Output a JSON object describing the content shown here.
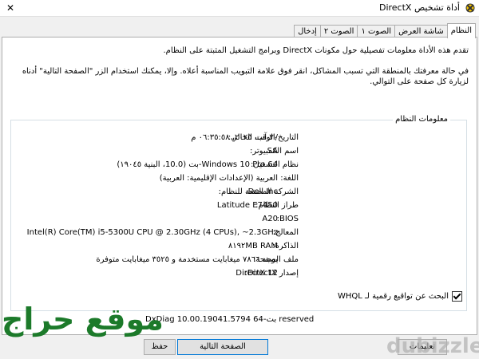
{
  "window": {
    "title": "أداة تشخيص DirectX",
    "close_label": "✕"
  },
  "tabs": [
    {
      "label": "النظام",
      "active": true
    },
    {
      "label": "شاشة العرض",
      "active": false
    },
    {
      "label": "الصوت ١",
      "active": false
    },
    {
      "label": "الصوت ٢",
      "active": false
    },
    {
      "label": "إدخال",
      "active": false
    }
  ],
  "intro": {
    "line1": "تقدم هذه الأداة معلومات تفصيلية حول مكونات DirectX وبرامج التشغيل المثبتة على النظام.",
    "line2": "في حالة معرفتك بالمنطقة التي تسبب المشاكل، انقر فوق علامة التبويب المناسبة أعلاه. وإلا، يمكنك استخدام الزر \"الصفحة التالية\" أدناه لزيارة كل صفحة على التوالي."
  },
  "system_info": {
    "title": "معلومات النظام",
    "rows": [
      {
        "label": "التاريخ/الوقت الحالي:",
        "value": "٣٠ آب، ٢٠٢٥، ٠٦:٣٥:٥٨ م"
      },
      {
        "label": "اسم الكمبيوتر:",
        "value": "SA"
      },
      {
        "label": "نظام التشغيل:",
        "value": "Windows 10 Pro 64-بت (10.0، البنية ١٩٠٤٥)"
      },
      {
        "label": "اللغة:",
        "value": "العربية (الإعدادات الإقليمية: العربية)"
      },
      {
        "label": "الشركة المصنعة للنظام:",
        "value": "Dell Inc."
      },
      {
        "label": "طراز النظام:",
        "value": "Latitude E7450"
      },
      {
        "label": "BIOS:",
        "value": "A20"
      },
      {
        "label": "المعالج:",
        "value": "Intel(R) Core(TM) i5-5300U CPU @ 2.30GHz (4 CPUs), ~2.3GHz"
      },
      {
        "label": "الذاكرة:",
        "value": "٨١٩٢MB RAM"
      },
      {
        "label": "ملف الصفحة:",
        "value": "يوجد ٧٨٦٦ ميغابايت مستخدمة و ٣٥٢٥ ميغابايت متوفرة"
      },
      {
        "label": "إصدار DirectX:",
        "value": "DirectX 12"
      }
    ]
  },
  "whql": {
    "label": "البحث عن تواقيع رقمية لـ WHQL",
    "checked": true
  },
  "version_line": "DxDiag 10.00.19041.5794 64-بت Copyright © Microsoft. All rights reserved",
  "version_visible": "DxDiag 10.00.19041.5794 64-بت reserved",
  "buttons": {
    "next": "الصفحة التالية",
    "save": "حفظ",
    "help": "تعليمات"
  },
  "watermarks": {
    "haraj": "موقع حراج",
    "dubizzle": "dubizzle"
  }
}
